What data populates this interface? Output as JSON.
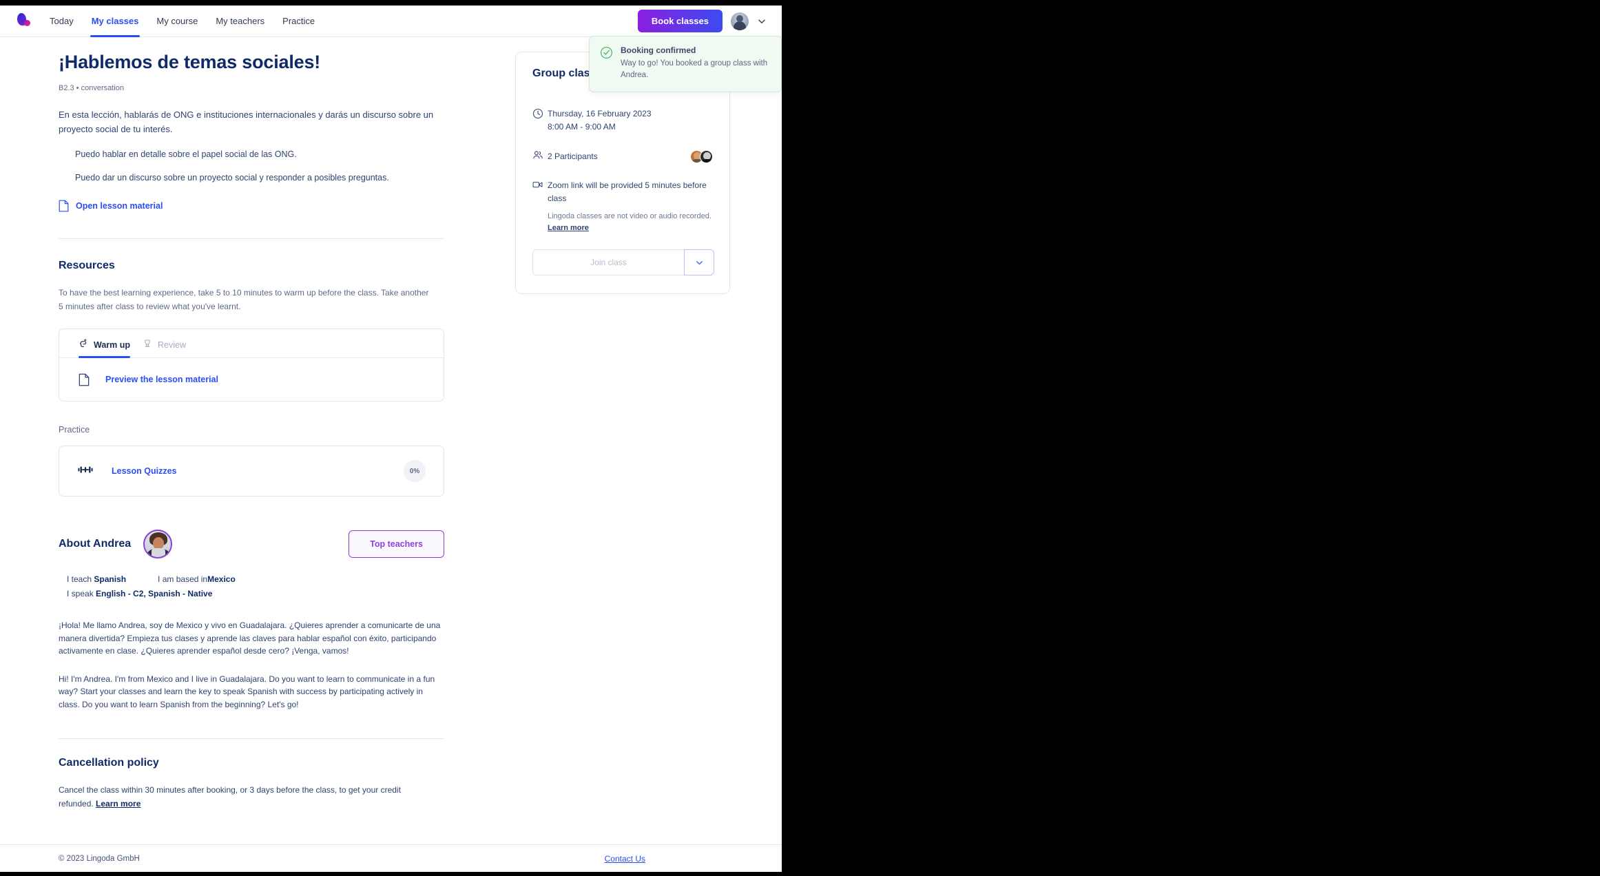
{
  "header": {
    "logo_name": "lingoda-logo",
    "nav": [
      {
        "label": "Today",
        "active": false
      },
      {
        "label": "My classes",
        "active": true
      },
      {
        "label": "My course",
        "active": false
      },
      {
        "label": "My teachers",
        "active": false
      },
      {
        "label": "Practice",
        "active": false
      }
    ],
    "book_classes_label": "Book classes",
    "book_classes_gradient_from": "#8b1fe0",
    "book_classes_gradient_to": "#3b4bf0"
  },
  "toast": {
    "icon": "check-circle-icon",
    "title": "Booking confirmed",
    "body": "Way to go! You booked a group class with Andrea.",
    "bg": "#f0faf2",
    "border": "#cfe9d6",
    "accent": "#3aa55d"
  },
  "lesson": {
    "title": "¡Hablemos de temas sociales!",
    "subtitle": "B2.3 • conversation",
    "description": "En esta lección, hablarás de ONG e instituciones internacionales y darás un discurso sobre un proyecto social de tu interés.",
    "goals": [
      "Puedo hablar en detalle sobre el papel social de las ONG.",
      "Puedo dar un discurso sobre un proyecto social y responder a posibles preguntas."
    ],
    "open_material_label": "Open lesson material"
  },
  "resources": {
    "heading": "Resources",
    "description": "To have the best learning experience, take 5 to 10 minutes to warm up before the class. Take another 5 minutes after class to review what you've learnt.",
    "tabs": [
      {
        "label": "Warm up",
        "icon": "warmup-icon",
        "active": true
      },
      {
        "label": "Review",
        "icon": "review-icon",
        "active": false
      }
    ],
    "preview_label": "Preview the lesson material"
  },
  "practice": {
    "label": "Practice",
    "quiz_name": "Lesson Quizzes",
    "quiz_icon": "dumbbell-icon",
    "progress": "0%"
  },
  "teacher": {
    "about_heading": "About Andrea",
    "badge_label": "Top teachers",
    "badge_color": "#8b3fd9",
    "fact_teach_label": "I teach ",
    "fact_teach_value": "Spanish",
    "fact_based_label": "I am based in ",
    "fact_based_value": "Mexico",
    "fact_speak_label": "I speak ",
    "fact_speak_value": "English - C2, Spanish - Native",
    "bio_es": "¡Hola! Me llamo Andrea, soy de Mexico y vivo en Guadalajara. ¿Quieres aprender a comunicarte de una manera divertida? Empieza tus clases y aprende las claves para hablar español con éxito, participando activamente en clase. ¿Quieres aprender español desde cero? ¡Venga, vamos!",
    "bio_en": "Hi! I'm Andrea. I'm from Mexico and I live in Guadalajara. Do you want to learn to communicate in a fun way? Start your classes and learn the key to speak Spanish with success by participating actively in class. Do you want to learn Spanish from the beginning? Let's go!"
  },
  "cancellation": {
    "heading": "Cancellation policy",
    "text": "Cancel the class within 30 minutes after booking, or 3 days before the class, to get your credit refunded. ",
    "learn_more": "Learn more"
  },
  "group_class": {
    "title": "Group class",
    "date": "Thursday, 16 February 2023",
    "time": "8:00 AM - 9:00 AM",
    "participants": "2 Participants",
    "zoom_note": "Zoom link will be provided 5 minutes before class",
    "recording_note": "Lingoda classes are not video or audio recorded. ",
    "learn_more": "Learn more",
    "join_label": "Join class",
    "clock_icon": "clock-icon",
    "people_icon": "people-icon",
    "video_icon": "video-camera-icon"
  },
  "footer": {
    "copyright": "© 2023 Lingoda GmbH",
    "contact": "Contact Us"
  }
}
